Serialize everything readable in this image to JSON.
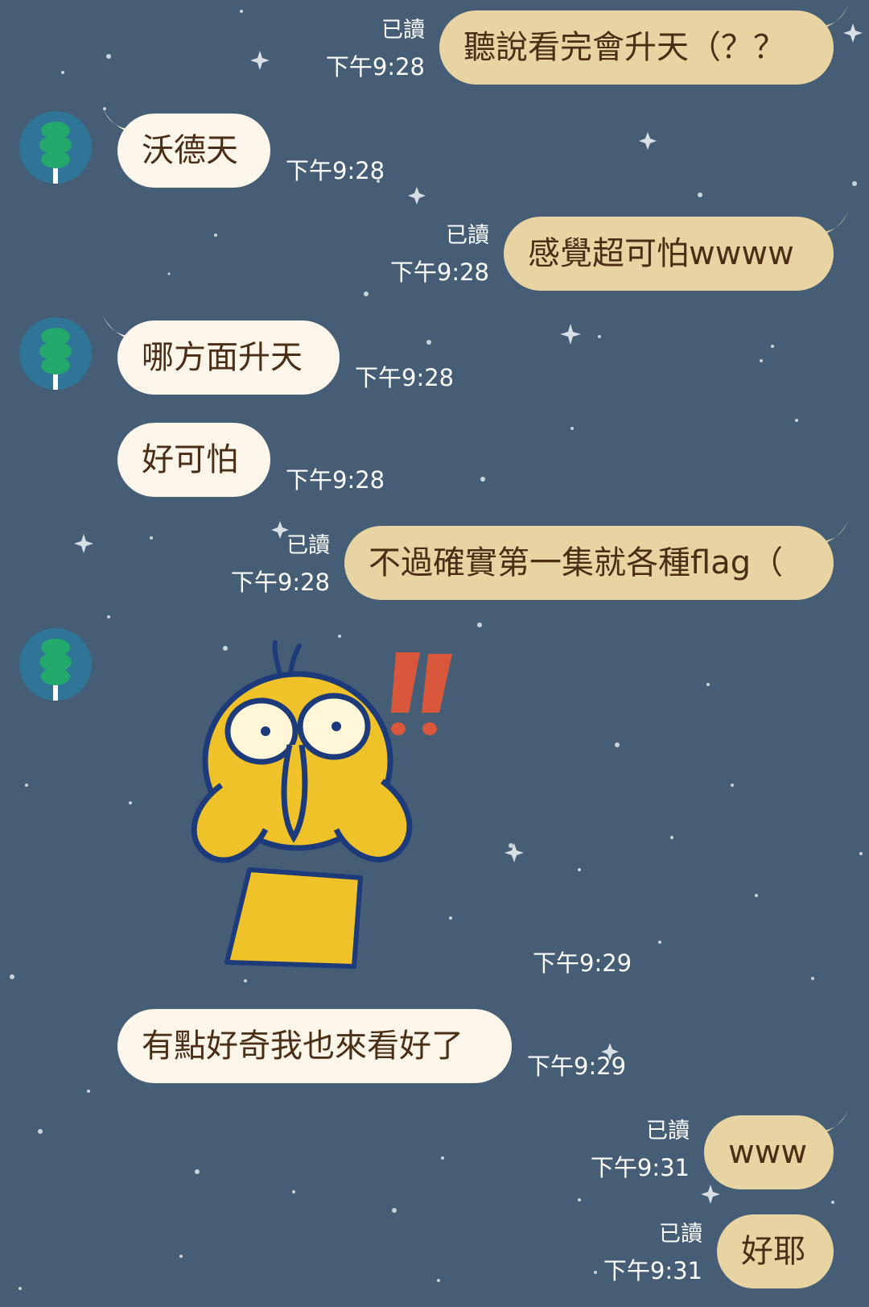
{
  "chat": {
    "messages": [
      {
        "sender": "me",
        "text": "聽說看完會升天（？？",
        "read": "已讀",
        "time": "下午9:28"
      },
      {
        "sender": "them",
        "text": "沃德天",
        "time": "下午9:28"
      },
      {
        "sender": "me",
        "text": "感覺超可怕wwww",
        "read": "已讀",
        "time": "下午9:28"
      },
      {
        "sender": "them",
        "text": "哪方面升天",
        "time": "下午9:28"
      },
      {
        "sender": "them",
        "text": "好可怕",
        "time": "下午9:28"
      },
      {
        "sender": "me",
        "text": "不過確實第一集就各種flag（",
        "read": "已讀",
        "time": "下午9:28"
      },
      {
        "sender": "them",
        "sticker": "yellow-duck-shocked-sticker",
        "time": "下午9:29"
      },
      {
        "sender": "them",
        "text": "有點好奇我也來看好了",
        "time": "下午9:29"
      },
      {
        "sender": "me",
        "text": "www",
        "read": "已讀",
        "time": "下午9:31"
      },
      {
        "sender": "me",
        "text": "好耶",
        "read": "已讀",
        "time": "下午9:31"
      }
    ]
  },
  "colors": {
    "background": "#465e75",
    "my_bubble": "#e8d4a2",
    "their_bubble": "#fcf6ea",
    "bubble_text": "#4a2e16",
    "avatar_bg": "#2f7597",
    "avatar_tree": "#23a96b"
  }
}
